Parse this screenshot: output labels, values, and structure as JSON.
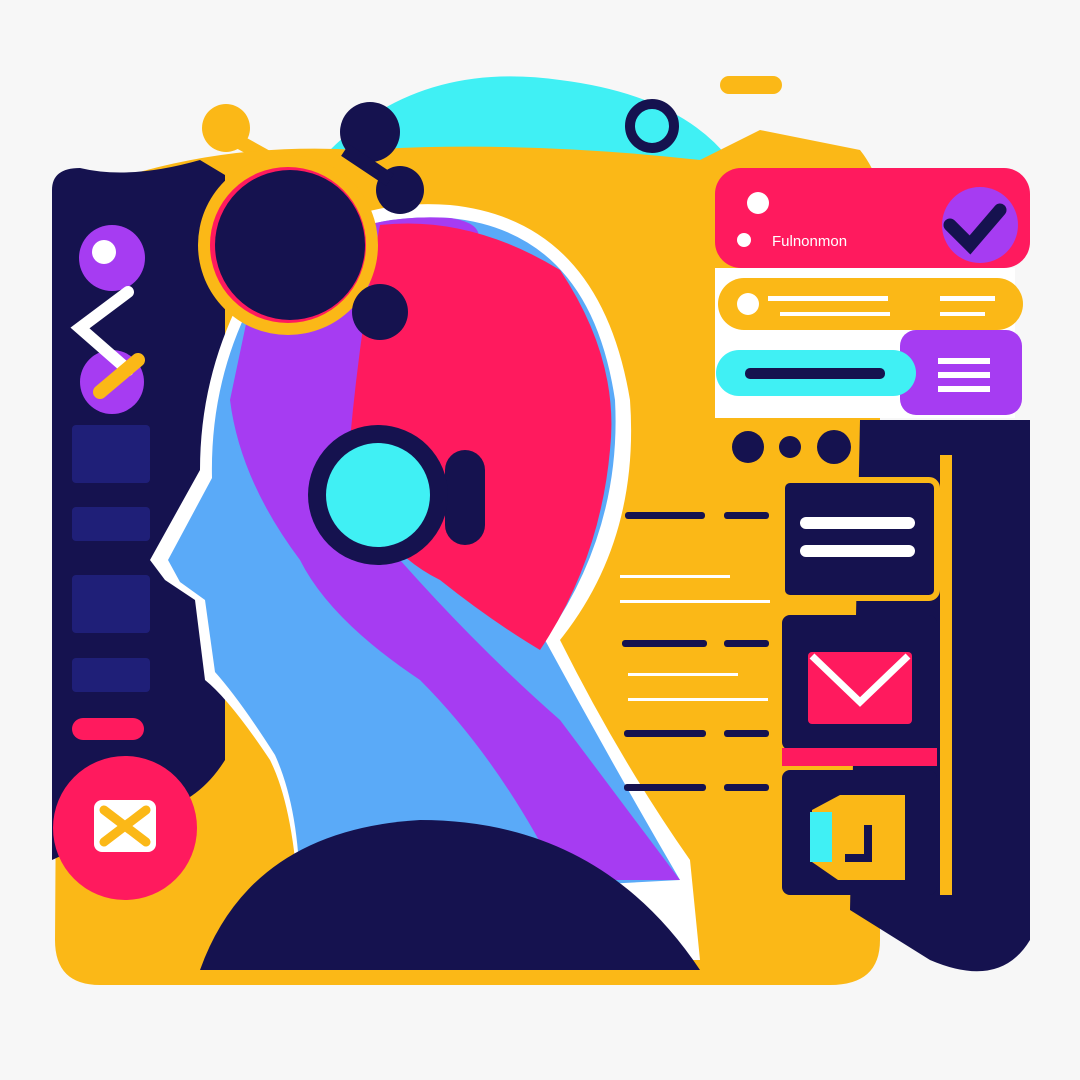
{
  "illustration": {
    "card_label": "Fulnonmon"
  },
  "palette": {
    "background": "#f7f7f7",
    "navy": "#15124f",
    "yellow": "#fbb817",
    "pink": "#ff1a5e",
    "purple": "#a63cf2",
    "cyan": "#40f0f4",
    "blue": "#5aaaf8",
    "white": "#ffffff"
  }
}
